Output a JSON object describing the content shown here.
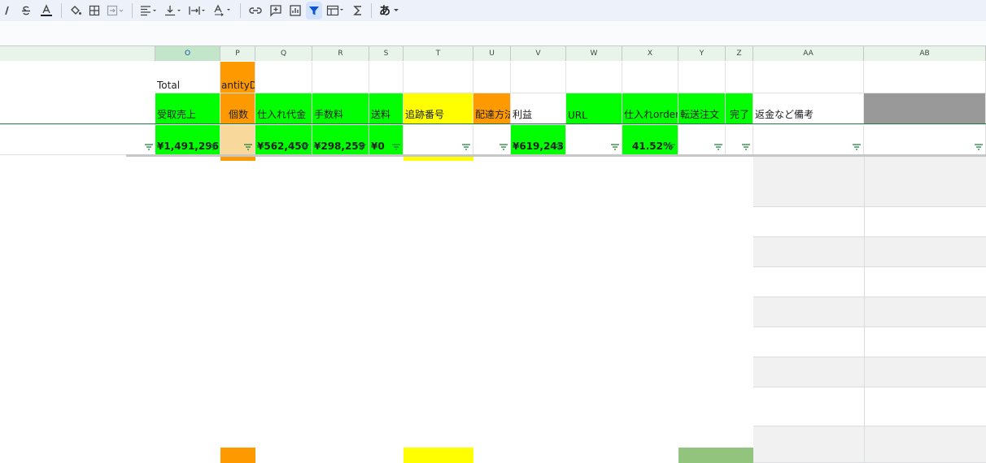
{
  "toolbar": {
    "items": [
      {
        "name": "italic-button",
        "icon": "italic-icon"
      },
      {
        "name": "strikethrough-button",
        "icon": "strikethrough-icon"
      },
      {
        "name": "text-color-button",
        "icon": "text-color-icon"
      },
      {
        "name": "fill-color-button",
        "icon": "paint-bucket-icon"
      },
      {
        "name": "borders-button",
        "icon": "borders-icon"
      },
      {
        "name": "merge-cells-button",
        "icon": "merge-icon"
      },
      {
        "name": "horizontal-align-button",
        "icon": "align-left-icon"
      },
      {
        "name": "vertical-align-button",
        "icon": "vertical-align-icon"
      },
      {
        "name": "text-wrap-button",
        "icon": "text-wrap-icon"
      },
      {
        "name": "text-rotation-button",
        "icon": "text-rotation-icon"
      },
      {
        "name": "insert-link-button",
        "icon": "link-icon"
      },
      {
        "name": "insert-comment-button",
        "icon": "comment-icon"
      },
      {
        "name": "insert-chart-button",
        "icon": "chart-icon"
      },
      {
        "name": "filter-button",
        "icon": "filter-icon"
      },
      {
        "name": "filter-views-button",
        "icon": "filter-views-icon"
      },
      {
        "name": "functions-button",
        "icon": "sigma-icon"
      },
      {
        "name": "input-tools-button",
        "icon": "input-tools-icon"
      }
    ],
    "input_tools_label": "あ"
  },
  "columns": [
    "O",
    "P",
    "Q",
    "R",
    "S",
    "T",
    "U",
    "V",
    "W",
    "X",
    "Y",
    "Z",
    "AA",
    "AB"
  ],
  "row1": {
    "O": "Total",
    "P": "antityDe"
  },
  "row2": {
    "O": "受取売上",
    "P": "個数",
    "Q": "仕入れ代金",
    "R": "手数料",
    "S": "送料",
    "T": "追跡番号",
    "U": "配達方法",
    "V": "利益",
    "W": "URL",
    "X": "仕入れorder",
    "Y": "転送注文",
    "Z": "完了",
    "AA": "返金など備考"
  },
  "row3": {
    "O": "¥1,491,296",
    "Q": "¥562,450",
    "R": "¥298,259",
    "S": "¥0",
    "V": "¥619,243",
    "X": "41.52%"
  },
  "colors": {
    "green": "#00ff00",
    "orange": "#ff9900",
    "yellow": "#ffff00",
    "gray": "#999999"
  }
}
